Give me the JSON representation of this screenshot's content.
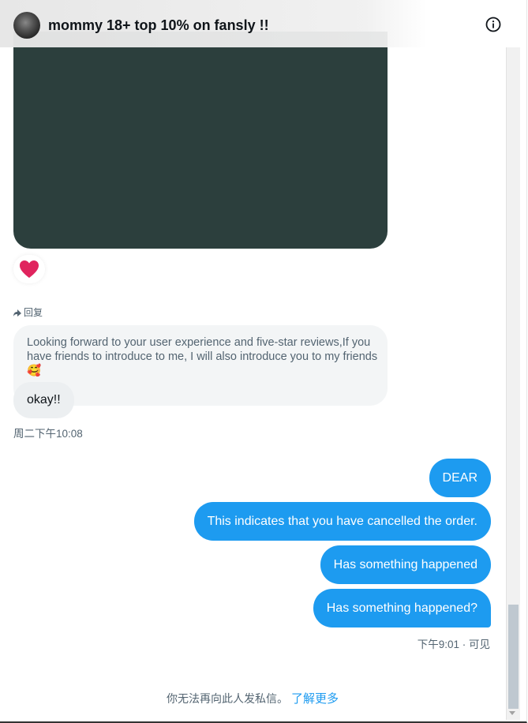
{
  "header": {
    "title": "mommy 18+ top 10% on fansly !!",
    "avatar_icon": "avatar-image",
    "info_icon": "info-circle-icon"
  },
  "media": {
    "color": "#2c3f3d"
  },
  "reaction": {
    "emoji_icon": "red-heart-icon",
    "color": "#e0245e"
  },
  "incoming": {
    "reply_label": "回复",
    "quoted_message": "Looking forward to your user experience and five-star reviews,If you have friends to introduce to me, I will also introduce you to my friends🥰",
    "message": "okay!!",
    "timestamp": "周二下午10:08"
  },
  "outgoing": {
    "messages": [
      "DEAR",
      "This indicates that you have cancelled the order.",
      "Has something happened",
      "Has something happened?"
    ],
    "timestamp": "下午9:01 · 可见",
    "bubble_color": "#1d9bf0"
  },
  "footer": {
    "notice": "你无法再向此人发私信。",
    "learn_more": "了解更多"
  }
}
